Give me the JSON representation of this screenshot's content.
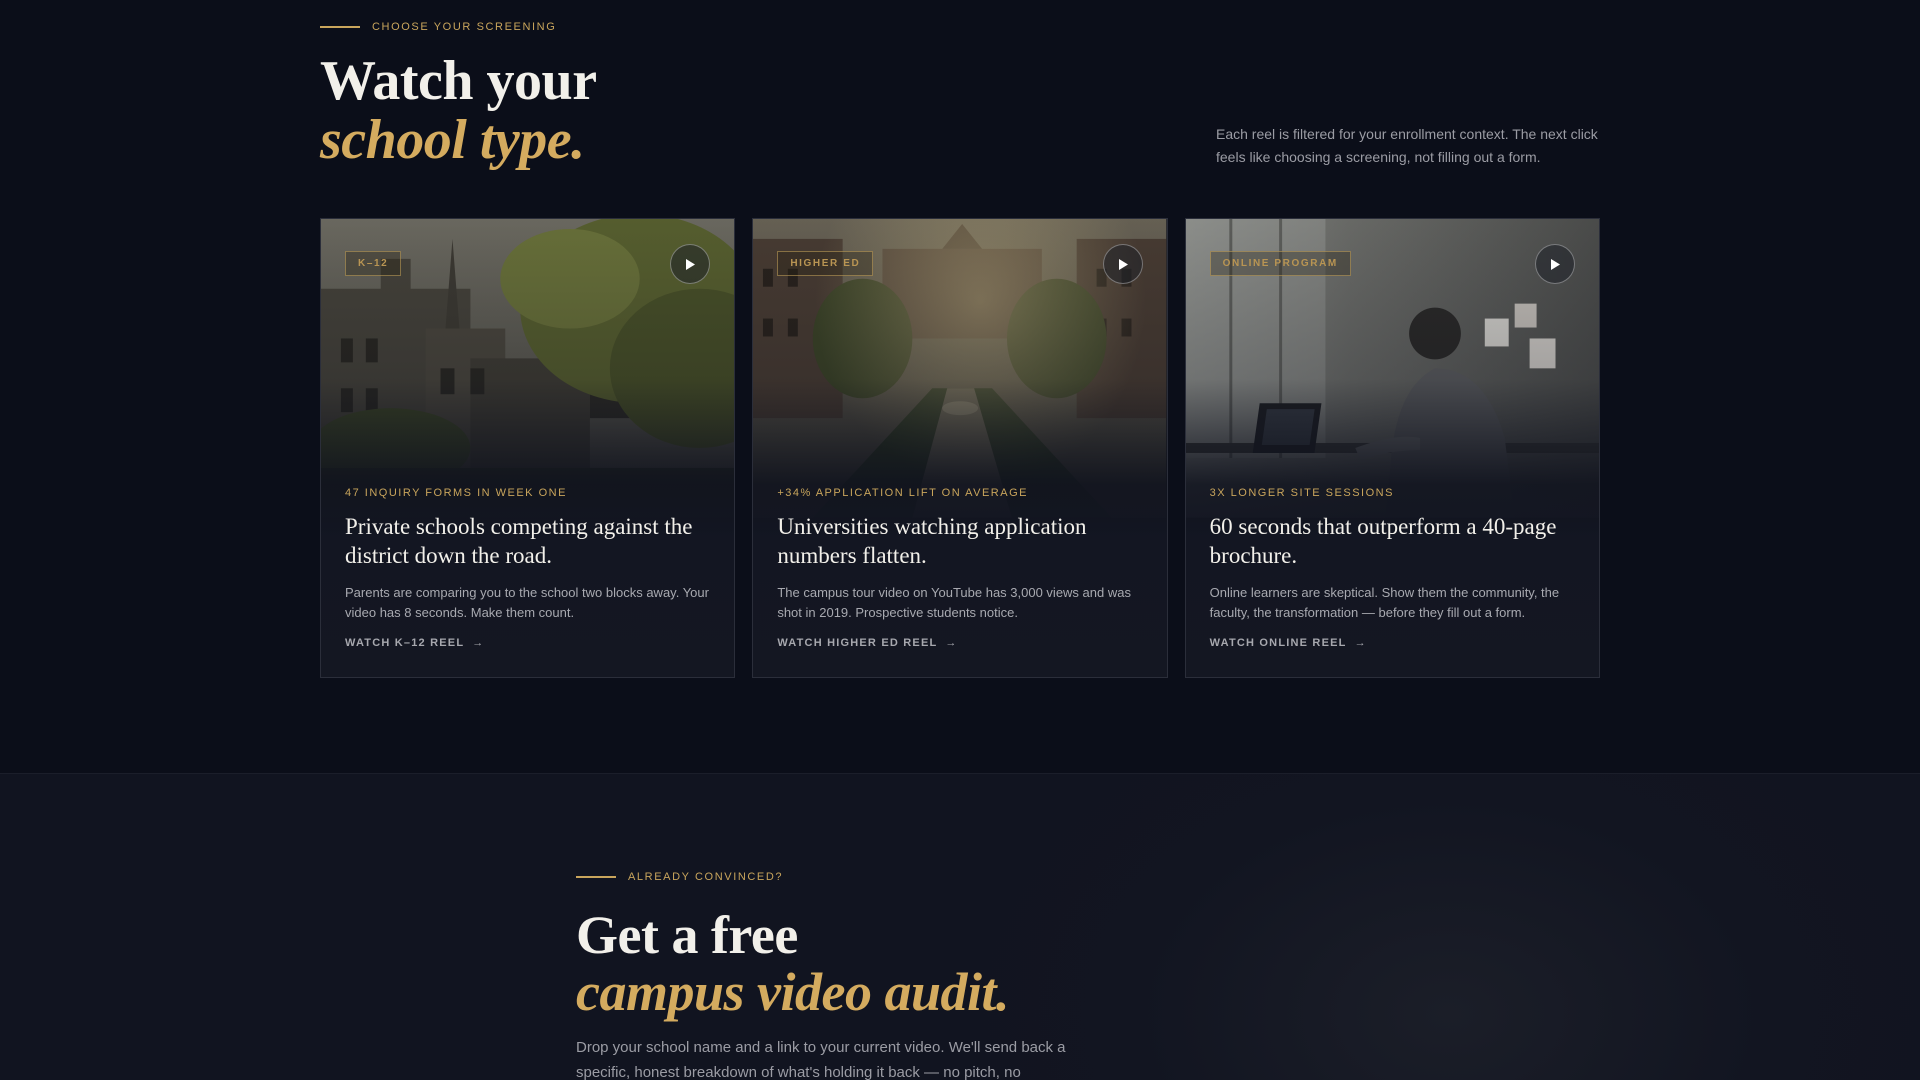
{
  "screening": {
    "eyebrow": "CHOOSE YOUR SCREENING",
    "title_line1": "Watch your",
    "title_line2": "school type.",
    "intro": "Each reel is filtered for your enrollment context. The next click feels like choosing a screening, not filling out a form."
  },
  "cards": [
    {
      "tag": "K–12",
      "stat": "47 INQUIRY FORMS IN WEEK ONE",
      "title": "Private schools competing against the district down the road.",
      "body": "Parents are comparing you to the school two blocks away. Your video has 8 seconds. Make them count.",
      "cta": "WATCH K–12 REEL",
      "play_icon": "play-icon",
      "arrow_icon": "arrow-right-icon"
    },
    {
      "tag": "HIGHER ED",
      "stat": "+34% APPLICATION LIFT ON AVERAGE",
      "title": "Universities watching application numbers flatten.",
      "body": "The campus tour video on YouTube has 3,000 views and was shot in 2019. Prospective students notice.",
      "cta": "WATCH HIGHER ED REEL",
      "play_icon": "play-icon",
      "arrow_icon": "arrow-right-icon"
    },
    {
      "tag": "ONLINE PROGRAM",
      "stat": "3X LONGER SITE SESSIONS",
      "title": "60 seconds that outperform a 40-page brochure.",
      "body": "Online learners are skeptical. Show them the community, the faculty, the transformation — before they fill out a form.",
      "cta": "WATCH ONLINE REEL",
      "play_icon": "play-icon",
      "arrow_icon": "arrow-right-icon"
    }
  ],
  "audit": {
    "eyebrow": "ALREADY CONVINCED?",
    "title_line1": "Get a free",
    "title_line2": "campus video audit.",
    "body": "Drop your school name and a link to your current video. We'll send back a specific, honest breakdown of what's holding it back — no pitch, no"
  },
  "colors": {
    "background": "#0b0e19",
    "accent_gold": "#c9a55c",
    "text_primary": "#f2f0ea",
    "text_muted": "#9b9ca4"
  }
}
